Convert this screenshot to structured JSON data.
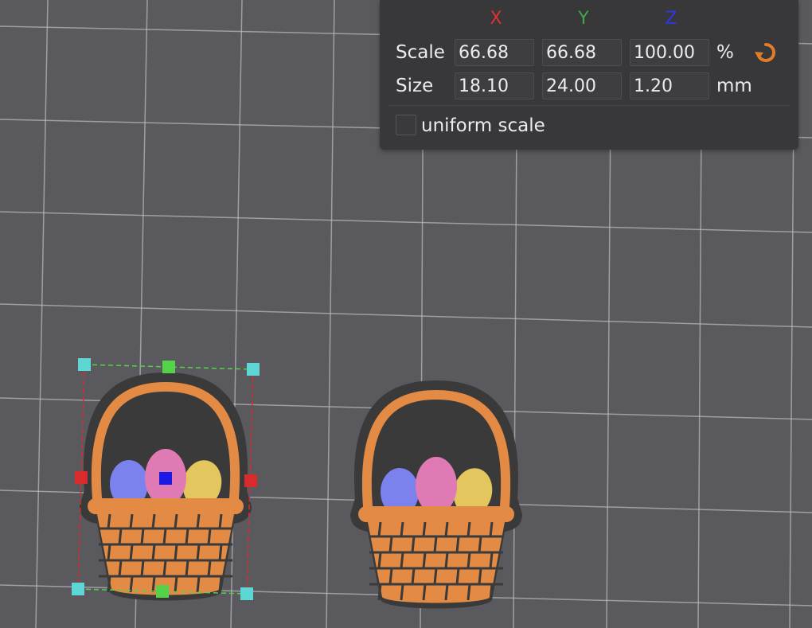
{
  "panel": {
    "axes": {
      "x": {
        "label": "X",
        "color": "#e0322f"
      },
      "y": {
        "label": "Y",
        "color": "#3fa64a"
      },
      "z": {
        "label": "Z",
        "color": "#2f36e6"
      }
    },
    "scale": {
      "label": "Scale",
      "x": "66.68",
      "y": "66.68",
      "z": "100.00",
      "unit": "%"
    },
    "size": {
      "label": "Size",
      "x": "18.10",
      "y": "24.00",
      "z": "1.20",
      "unit": "mm"
    },
    "uniform_scale": {
      "label": "uniform scale",
      "checked": false
    },
    "reset_icon": "reset-arrow-icon",
    "accent_color": "#e07c2a"
  },
  "scene": {
    "objects": [
      {
        "name": "easter-basket",
        "selected": true
      },
      {
        "name": "easter-basket",
        "selected": false
      }
    ],
    "handle_colors": {
      "corner": "#5fd6d6",
      "x_axis": "#d92b2b",
      "y_axis": "#55d14a",
      "center": "#1a1ae6"
    },
    "colors": {
      "background": "#5a5a5e",
      "grid": "#bcbcc0",
      "basket_fill": "#e38a45",
      "basket_outline": "#3a3a3a",
      "egg_blue": "#7b82ee",
      "egg_pink": "#e07ab4",
      "egg_yellow": "#e3c65e"
    }
  }
}
